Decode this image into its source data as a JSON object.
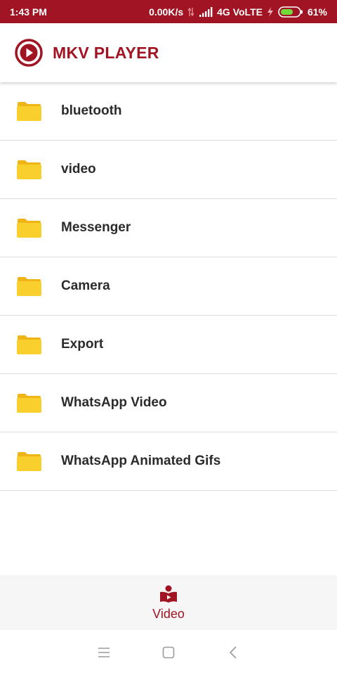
{
  "status_bar": {
    "time": "1:43 PM",
    "network_speed": "0.00K/s",
    "network_type": "4G VoLTE",
    "battery": "61%",
    "icons": [
      "data-arrows-icon",
      "signal-icon",
      "charging-icon",
      "battery-icon"
    ]
  },
  "app_bar": {
    "title": "MKV PLAYER",
    "logo_icon": "play-circle-icon"
  },
  "folders": [
    {
      "name": "bluetooth",
      "icon": "folder-icon"
    },
    {
      "name": "video",
      "icon": "folder-icon"
    },
    {
      "name": "Messenger",
      "icon": "folder-icon"
    },
    {
      "name": "Camera",
      "icon": "folder-icon"
    },
    {
      "name": "Export",
      "icon": "folder-icon"
    },
    {
      "name": "WhatsApp Video",
      "icon": "folder-icon"
    },
    {
      "name": "WhatsApp Animated Gifs",
      "icon": "folder-icon"
    }
  ],
  "bottom_nav": {
    "tabs": [
      {
        "label": "Video",
        "icon": "video-library-icon",
        "selected": true
      }
    ]
  },
  "system_nav": {
    "buttons": [
      "menu-icon",
      "home-icon",
      "back-icon"
    ]
  },
  "colors": {
    "accent": "#a01423",
    "folder": "#f9cf2e",
    "folder_tab": "#f0b415",
    "text": "#2b2b2b",
    "bottom_nav_bg": "#f6f6f6"
  }
}
